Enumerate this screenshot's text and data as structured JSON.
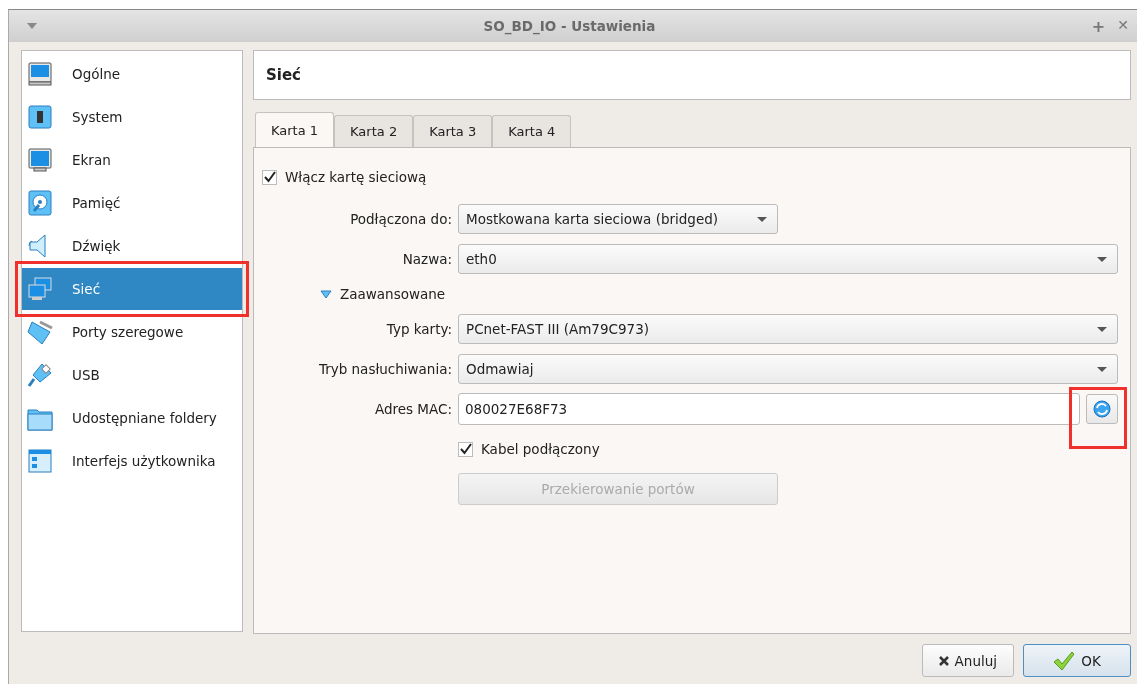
{
  "window": {
    "title": "SO_BD_IO - Ustawienia",
    "controls": [
      {
        "kind": "pin",
        "label": "+"
      },
      {
        "kind": "close",
        "label": "✕"
      }
    ]
  },
  "sidebar": {
    "items": [
      {
        "label": "Ogólne",
        "kind": "general",
        "selected": false,
        "highlighted": false
      },
      {
        "label": "System",
        "kind": "system",
        "selected": false,
        "highlighted": false
      },
      {
        "label": "Ekran",
        "kind": "display",
        "selected": false,
        "highlighted": false
      },
      {
        "label": "Pamięć",
        "kind": "storage",
        "selected": false,
        "highlighted": false
      },
      {
        "label": "Dźwięk",
        "kind": "audio",
        "selected": false,
        "highlighted": false
      },
      {
        "label": "Sieć",
        "kind": "network",
        "selected": true,
        "highlighted": true
      },
      {
        "label": "Porty szeregowe",
        "kind": "serial",
        "selected": false,
        "highlighted": false
      },
      {
        "label": "USB",
        "kind": "usb",
        "selected": false,
        "highlighted": false
      },
      {
        "label": "Udostępniane foldery",
        "kind": "folder",
        "selected": false,
        "highlighted": false
      },
      {
        "label": "Interfejs użytkownika",
        "kind": "ui",
        "selected": false,
        "highlighted": false
      }
    ]
  },
  "page_header": "Sieć",
  "tabs": [
    {
      "label": "Karta 1",
      "selected": true
    },
    {
      "label": "Karta 2",
      "selected": false
    },
    {
      "label": "Karta 3",
      "selected": false
    },
    {
      "label": "Karta 4",
      "selected": false
    }
  ],
  "form": {
    "rows": [
      {
        "kind": "checkbox",
        "label": "Włącz kartę sieciową",
        "checked": true
      },
      {
        "kind": "compact-combo",
        "label": "Podłączona do:",
        "value": "Mostkowana karta sieciowa (bridged)"
      },
      {
        "kind": "combo",
        "label": "Nazwa:",
        "value": "eth0"
      },
      {
        "kind": "disclosure",
        "label": "Zaawansowane",
        "expanded": true
      },
      {
        "kind": "combo",
        "label": "Typ karty:",
        "value": "PCnet-FAST III (Am79C973)"
      },
      {
        "kind": "combo",
        "label": "Tryb nasłuchiwania:",
        "value": "Odmawiaj"
      },
      {
        "kind": "mac",
        "label": "Adres MAC:",
        "value": "080027E68F73",
        "button_highlighted": true
      },
      {
        "kind": "indented-checkbox",
        "label": "Kabel podłączony",
        "checked": true
      },
      {
        "kind": "button",
        "label": "Przekierowanie portów",
        "disabled": true
      }
    ]
  },
  "buttons": [
    {
      "kind": "cancel",
      "label": "Anuluj",
      "default": false
    },
    {
      "kind": "ok",
      "label": "OK",
      "default": true
    }
  ]
}
